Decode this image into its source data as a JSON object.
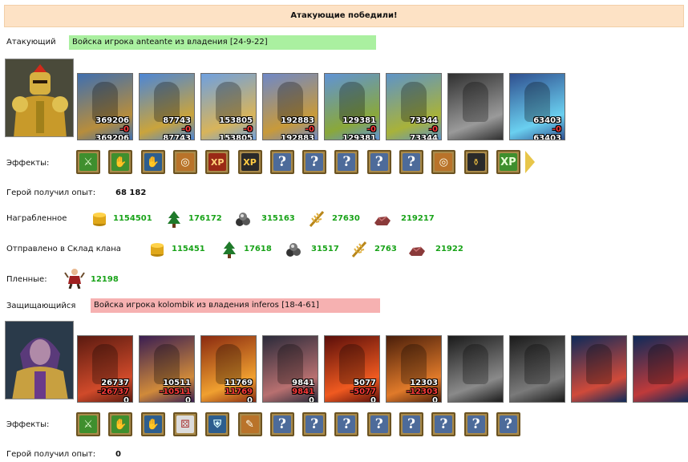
{
  "banner": "Атакующие победили!",
  "attacker": {
    "label": "Атакующий",
    "army_text": "Войска игрока anteante из владения [24-9-22]",
    "units": [
      {
        "n1": "369206",
        "n2": "-0",
        "n3": "369206",
        "c1": "#3f6fb0",
        "c2": "#b78d3c"
      },
      {
        "n1": "87743",
        "n2": "-0",
        "n3": "87743",
        "c1": "#4c86d6",
        "c2": "#caa43c"
      },
      {
        "n1": "153805",
        "n2": "-0",
        "n3": "153805",
        "c1": "#6ea0e0",
        "c2": "#d8b45a"
      },
      {
        "n1": "192883",
        "n2": "-0",
        "n3": "192883",
        "c1": "#6e88c8",
        "c2": "#c89a3a"
      },
      {
        "n1": "129381",
        "n2": "-0",
        "n3": "129381",
        "c1": "#5f93d6",
        "c2": "#8aa83a"
      },
      {
        "n1": "73344",
        "n2": "-0",
        "n3": "73344",
        "c1": "#5e94c8",
        "c2": "#a8b23a"
      },
      {
        "n1": "",
        "n2": "",
        "n3": "",
        "c1": "#303030",
        "c2": "#9a9a9a"
      },
      {
        "n1": "63403",
        "n2": "-0",
        "n3": "63403",
        "c1": "#2f4f8f",
        "c2": "#6ad0f0"
      }
    ],
    "effects_label": "Эффекты:",
    "effects": [
      {
        "icon": "sword-icon",
        "glyph": "⚔",
        "cls": "g"
      },
      {
        "icon": "handshake-icon",
        "glyph": "✋",
        "cls": "g"
      },
      {
        "icon": "hand-icon",
        "glyph": "✋",
        "cls": "b"
      },
      {
        "icon": "coins-icon",
        "glyph": "◎",
        "cls": "o"
      },
      {
        "icon": "xp-icon",
        "glyph": "XP",
        "cls": "r"
      },
      {
        "icon": "goblin-xp-icon",
        "glyph": "XP",
        "cls": "d"
      },
      {
        "icon": "question-icon",
        "glyph": "?",
        "cls": "q"
      },
      {
        "icon": "question-icon",
        "glyph": "?",
        "cls": "q"
      },
      {
        "icon": "question-icon",
        "glyph": "?",
        "cls": "q"
      },
      {
        "icon": "question-icon",
        "glyph": "?",
        "cls": "q"
      },
      {
        "icon": "question-icon",
        "glyph": "?",
        "cls": "q"
      },
      {
        "icon": "coins-icon",
        "glyph": "◎",
        "cls": "o"
      },
      {
        "icon": "totem-icon",
        "glyph": "⚱",
        "cls": "d"
      },
      {
        "icon": "xp-icon",
        "glyph": "XP",
        "cls": "g"
      }
    ],
    "hero_xp_label": "Герой получил опыт:",
    "hero_xp": "68 182"
  },
  "loot": {
    "label": "Награбленное",
    "gold": "1154501",
    "wood": "176172",
    "ore": "315163",
    "wheat": "27630",
    "stone": "219217"
  },
  "clan": {
    "label": "Отправлено в Склад клана",
    "gold": "115451",
    "wood": "17618",
    "ore": "31517",
    "wheat": "2763",
    "stone": "21922"
  },
  "prisoners": {
    "label": "Пленные:",
    "value": "12198"
  },
  "defender": {
    "label": "Защищающийся",
    "army_text": "Войска игрока kolombik из владения inferos [18-4-61]",
    "units": [
      {
        "n1": "26737",
        "n2": "-26737",
        "n3": "0",
        "c1": "#5a1a10",
        "c2": "#d04a2a"
      },
      {
        "n1": "10511",
        "n2": "-10511",
        "n3": "0",
        "c1": "#3a1e52",
        "c2": "#d08a3a"
      },
      {
        "n1": "11769",
        "n2": "11769",
        "n3": "0",
        "c1": "#8a2a10",
        "c2": "#f0a030"
      },
      {
        "n1": "9841",
        "n2": "9841",
        "n3": "0",
        "c1": "#2a2a3a",
        "c2": "#b87070"
      },
      {
        "n1": "5077",
        "n2": "-5077",
        "n3": "0",
        "c1": "#5a0e0a",
        "c2": "#f05a20"
      },
      {
        "n1": "12303",
        "n2": "-12303",
        "n3": "0",
        "c1": "#4a1e0a",
        "c2": "#e07a2a"
      },
      {
        "n1": "",
        "n2": "",
        "n3": "",
        "c1": "#1a1a1a",
        "c2": "#8a8a8a"
      },
      {
        "n1": "",
        "n2": "",
        "n3": "",
        "c1": "#1a1a1a",
        "c2": "#7a7a7a"
      },
      {
        "n1": "",
        "n2": "",
        "n3": "",
        "c1": "#0e2a5a",
        "c2": "#d04a3a"
      },
      {
        "n1": "",
        "n2": "",
        "n3": "",
        "c1": "#0e2a5a",
        "c2": "#c03a3a"
      }
    ],
    "effects_label": "Эффекты:",
    "effects": [
      {
        "icon": "sword-icon",
        "glyph": "⚔",
        "cls": "g"
      },
      {
        "icon": "handshake-icon",
        "glyph": "✋",
        "cls": "g"
      },
      {
        "icon": "hand-icon",
        "glyph": "✋",
        "cls": "b"
      },
      {
        "icon": "dice-icon",
        "glyph": "⚄",
        "cls": "w"
      },
      {
        "icon": "shield-icon",
        "glyph": "⛨",
        "cls": "b"
      },
      {
        "icon": "scroll-icon",
        "glyph": "✎",
        "cls": "o"
      },
      {
        "icon": "question-icon",
        "glyph": "?",
        "cls": "q"
      },
      {
        "icon": "question-icon",
        "glyph": "?",
        "cls": "q"
      },
      {
        "icon": "question-icon",
        "glyph": "?",
        "cls": "q"
      },
      {
        "icon": "question-icon",
        "glyph": "?",
        "cls": "q"
      },
      {
        "icon": "question-icon",
        "glyph": "?",
        "cls": "q"
      },
      {
        "icon": "question-icon",
        "glyph": "?",
        "cls": "q"
      },
      {
        "icon": "question-icon",
        "glyph": "?",
        "cls": "q"
      },
      {
        "icon": "question-icon",
        "glyph": "?",
        "cls": "q"
      }
    ],
    "hero_xp_label": "Герой получил опыт:",
    "hero_xp": "0"
  }
}
